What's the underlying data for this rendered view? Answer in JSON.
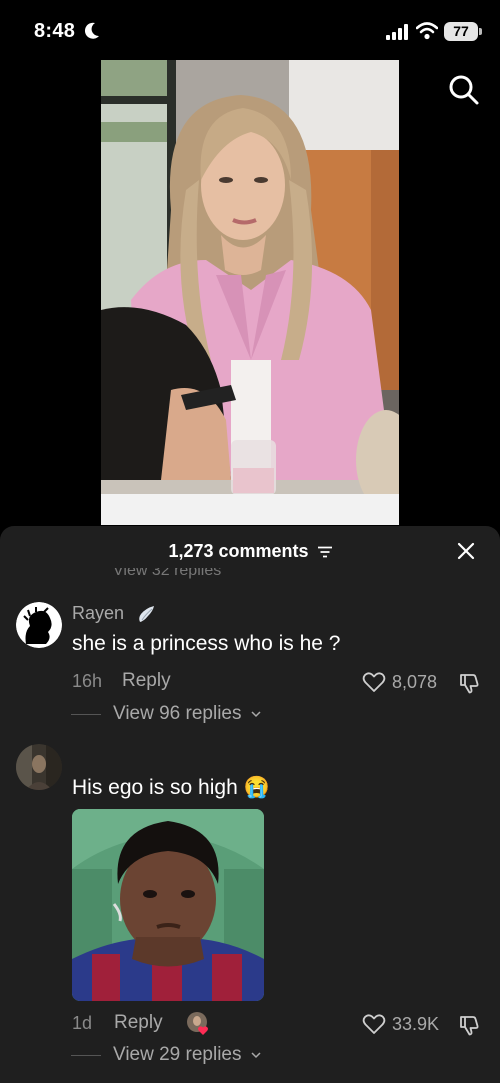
{
  "status_bar": {
    "time": "8:48",
    "battery": "77"
  },
  "comments_header": {
    "count_label": "1,273 comments",
    "partial_above": "View 32 replies"
  },
  "comments": [
    {
      "username": "Rayen",
      "text": "she is a princess who is he ?",
      "age": "16h",
      "reply_label": "Reply",
      "likes": "8,078",
      "view_replies": "View 96 replies"
    },
    {
      "username": "",
      "text": "His ego is so high 😭",
      "age": "1d",
      "reply_label": "Reply",
      "likes": "33.9K",
      "view_replies": "View 29 replies"
    }
  ],
  "colors": {
    "sheet_bg": "#1f1f1f",
    "muted_text": "#a9a9a9",
    "jacket_pink": "#e6a7c8"
  },
  "icons": [
    "moon-icon",
    "signal-icon",
    "wifi-icon",
    "search-icon",
    "filter-icon",
    "close-icon",
    "angel-wing-icon",
    "heart-icon",
    "dislike-icon",
    "chevron-down-icon"
  ]
}
